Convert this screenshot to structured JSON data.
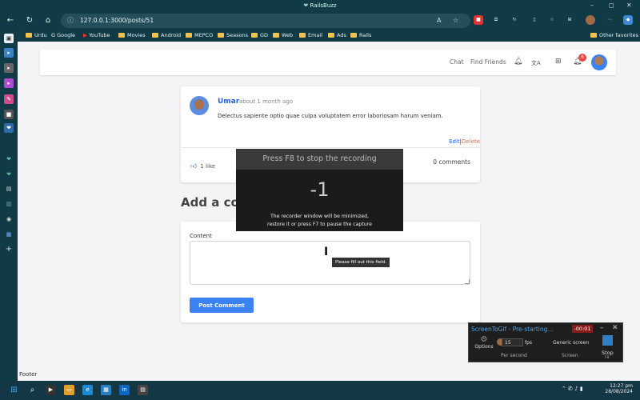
{
  "browser": {
    "window_title": "RailsBuzz",
    "url": "127.0.0.1:3000/posts/51",
    "bookmarks": [
      "Urdu",
      "Google",
      "YouTube",
      "Movies",
      "Android",
      "MEPCO",
      "Seasons",
      "GD",
      "Web",
      "Email",
      "Ads",
      "Rails"
    ],
    "other_favorites": "Other favorites",
    "window_controls": [
      "–",
      "◻",
      "✕"
    ]
  },
  "nav": {
    "chat": "Chat",
    "find_friends": "Find Friends",
    "notification_count": "6",
    "translate_icon_text": "文A"
  },
  "post": {
    "author": "Umar",
    "time": "about 1 month ago",
    "body": "Delectus sapiente optio quae culpa voluptatem error laboriosam harum veniam.",
    "edit": "Edit",
    "separator": "|",
    "delete": "Delete",
    "likes": "1 like",
    "comments": "0 comments"
  },
  "comment_form": {
    "heading": "Add a comment",
    "content_label": "Content",
    "submit": "Post Comment",
    "validation_tooltip": "Please fill out this field."
  },
  "footer": {
    "text": "Footer"
  },
  "recorder_overlay": {
    "header": "Press F8 to stop the recording",
    "countdown": "-1",
    "hint_line1": "The recorder window will be minimized,",
    "hint_line2": "restore it or press F7 to pause the capture"
  },
  "screentogif": {
    "title": "ScreenToGif - Pre-starting...",
    "timer": "-00:01",
    "options": "Options",
    "fps_value": "15",
    "fps_unit": "fps",
    "per_second": "Per second",
    "generic_screen": "Generic screen",
    "screen": "Screen",
    "stop": "Stop",
    "stop_key": "F8"
  },
  "taskbar": {
    "time": "12:27 pm",
    "date": "28/08/2024"
  },
  "colors": {
    "chrome": "#0f3a46",
    "accent_blue": "#3b82f6",
    "link_blue": "#2563eb",
    "delete_orange": "#e86a4a",
    "badge_red": "#ef4444"
  }
}
